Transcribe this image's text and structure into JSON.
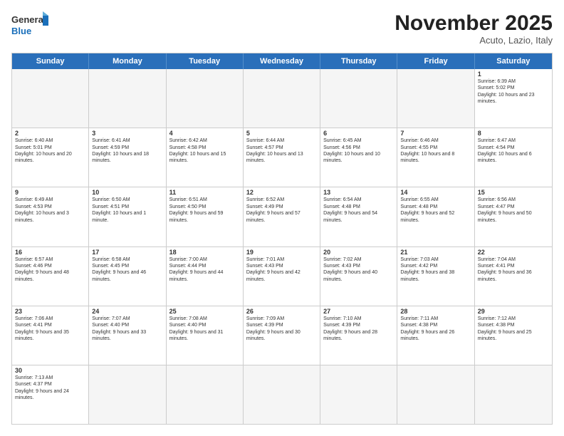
{
  "logo": {
    "general": "General",
    "blue": "Blue"
  },
  "title": "November 2025",
  "location": "Acuto, Lazio, Italy",
  "day_headers": [
    "Sunday",
    "Monday",
    "Tuesday",
    "Wednesday",
    "Thursday",
    "Friday",
    "Saturday"
  ],
  "weeks": [
    [
      {
        "num": "",
        "info": "",
        "empty": true
      },
      {
        "num": "",
        "info": "",
        "empty": true
      },
      {
        "num": "",
        "info": "",
        "empty": true
      },
      {
        "num": "",
        "info": "",
        "empty": true
      },
      {
        "num": "",
        "info": "",
        "empty": true
      },
      {
        "num": "",
        "info": "",
        "empty": true
      },
      {
        "num": "1",
        "info": "Sunrise: 6:39 AM\nSunset: 5:02 PM\nDaylight: 10 hours and 23 minutes."
      }
    ],
    [
      {
        "num": "2",
        "info": "Sunrise: 6:40 AM\nSunset: 5:01 PM\nDaylight: 10 hours and 20 minutes."
      },
      {
        "num": "3",
        "info": "Sunrise: 6:41 AM\nSunset: 4:59 PM\nDaylight: 10 hours and 18 minutes."
      },
      {
        "num": "4",
        "info": "Sunrise: 6:42 AM\nSunset: 4:58 PM\nDaylight: 10 hours and 15 minutes."
      },
      {
        "num": "5",
        "info": "Sunrise: 6:44 AM\nSunset: 4:57 PM\nDaylight: 10 hours and 13 minutes."
      },
      {
        "num": "6",
        "info": "Sunrise: 6:45 AM\nSunset: 4:56 PM\nDaylight: 10 hours and 10 minutes."
      },
      {
        "num": "7",
        "info": "Sunrise: 6:46 AM\nSunset: 4:55 PM\nDaylight: 10 hours and 8 minutes."
      },
      {
        "num": "8",
        "info": "Sunrise: 6:47 AM\nSunset: 4:54 PM\nDaylight: 10 hours and 6 minutes."
      }
    ],
    [
      {
        "num": "9",
        "info": "Sunrise: 6:49 AM\nSunset: 4:53 PM\nDaylight: 10 hours and 3 minutes."
      },
      {
        "num": "10",
        "info": "Sunrise: 6:50 AM\nSunset: 4:51 PM\nDaylight: 10 hours and 1 minute."
      },
      {
        "num": "11",
        "info": "Sunrise: 6:51 AM\nSunset: 4:50 PM\nDaylight: 9 hours and 59 minutes."
      },
      {
        "num": "12",
        "info": "Sunrise: 6:52 AM\nSunset: 4:49 PM\nDaylight: 9 hours and 57 minutes."
      },
      {
        "num": "13",
        "info": "Sunrise: 6:54 AM\nSunset: 4:48 PM\nDaylight: 9 hours and 54 minutes."
      },
      {
        "num": "14",
        "info": "Sunrise: 6:55 AM\nSunset: 4:48 PM\nDaylight: 9 hours and 52 minutes."
      },
      {
        "num": "15",
        "info": "Sunrise: 6:56 AM\nSunset: 4:47 PM\nDaylight: 9 hours and 50 minutes."
      }
    ],
    [
      {
        "num": "16",
        "info": "Sunrise: 6:57 AM\nSunset: 4:46 PM\nDaylight: 9 hours and 48 minutes."
      },
      {
        "num": "17",
        "info": "Sunrise: 6:58 AM\nSunset: 4:45 PM\nDaylight: 9 hours and 46 minutes."
      },
      {
        "num": "18",
        "info": "Sunrise: 7:00 AM\nSunset: 4:44 PM\nDaylight: 9 hours and 44 minutes."
      },
      {
        "num": "19",
        "info": "Sunrise: 7:01 AM\nSunset: 4:43 PM\nDaylight: 9 hours and 42 minutes."
      },
      {
        "num": "20",
        "info": "Sunrise: 7:02 AM\nSunset: 4:43 PM\nDaylight: 9 hours and 40 minutes."
      },
      {
        "num": "21",
        "info": "Sunrise: 7:03 AM\nSunset: 4:42 PM\nDaylight: 9 hours and 38 minutes."
      },
      {
        "num": "22",
        "info": "Sunrise: 7:04 AM\nSunset: 4:41 PM\nDaylight: 9 hours and 36 minutes."
      }
    ],
    [
      {
        "num": "23",
        "info": "Sunrise: 7:06 AM\nSunset: 4:41 PM\nDaylight: 9 hours and 35 minutes."
      },
      {
        "num": "24",
        "info": "Sunrise: 7:07 AM\nSunset: 4:40 PM\nDaylight: 9 hours and 33 minutes."
      },
      {
        "num": "25",
        "info": "Sunrise: 7:08 AM\nSunset: 4:40 PM\nDaylight: 9 hours and 31 minutes."
      },
      {
        "num": "26",
        "info": "Sunrise: 7:09 AM\nSunset: 4:39 PM\nDaylight: 9 hours and 30 minutes."
      },
      {
        "num": "27",
        "info": "Sunrise: 7:10 AM\nSunset: 4:39 PM\nDaylight: 9 hours and 28 minutes."
      },
      {
        "num": "28",
        "info": "Sunrise: 7:11 AM\nSunset: 4:38 PM\nDaylight: 9 hours and 26 minutes."
      },
      {
        "num": "29",
        "info": "Sunrise: 7:12 AM\nSunset: 4:38 PM\nDaylight: 9 hours and 25 minutes."
      }
    ],
    [
      {
        "num": "30",
        "info": "Sunrise: 7:13 AM\nSunset: 4:37 PM\nDaylight: 9 hours and 24 minutes."
      },
      {
        "num": "",
        "info": "",
        "empty": true
      },
      {
        "num": "",
        "info": "",
        "empty": true
      },
      {
        "num": "",
        "info": "",
        "empty": true
      },
      {
        "num": "",
        "info": "",
        "empty": true
      },
      {
        "num": "",
        "info": "",
        "empty": true
      },
      {
        "num": "",
        "info": "",
        "empty": true
      }
    ]
  ]
}
